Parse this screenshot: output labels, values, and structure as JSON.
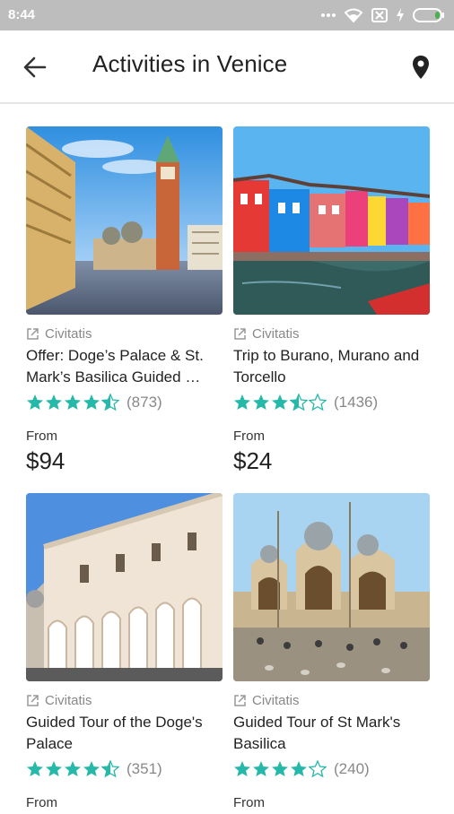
{
  "status_bar": {
    "time": "8:44",
    "icons": [
      "dots-icon",
      "wifi-icon",
      "sim-icon",
      "charging-icon",
      "battery-icon"
    ]
  },
  "app_bar": {
    "title": "Activities in Venice",
    "back_icon": "arrow-back-icon",
    "location_icon": "location-pin-icon"
  },
  "colors": {
    "accent_teal": "#26b8a8",
    "star_empty": "#26b8a8",
    "status_bar_bg": "#bdbdbd",
    "muted_text": "#888888"
  },
  "cards": [
    {
      "provider": "Civitatis",
      "title": "Offer: Doge’s Palace & St. Mark’s Basilica Guided …",
      "rating": 4.5,
      "reviews": "(873)",
      "from_label": "From",
      "price": "$94",
      "image": "st-mark-square-campanile-photo"
    },
    {
      "provider": "Civitatis",
      "title": "Trip to Burano, Murano and Torcello",
      "rating": 3.5,
      "reviews": "(1436)",
      "from_label": "From",
      "price": "$24",
      "image": "burano-colorful-houses-photo"
    },
    {
      "provider": "Civitatis",
      "title": "Guided Tour of the Doge's Palace",
      "rating": 4.5,
      "reviews": "(351)",
      "from_label": "From",
      "price": "",
      "image": "doges-palace-photo"
    },
    {
      "provider": "Civitatis",
      "title": "Guided Tour of St Mark's Basilica",
      "rating": 4,
      "reviews": "(240)",
      "from_label": "From",
      "price": "",
      "image": "st-marks-basilica-photo"
    }
  ]
}
